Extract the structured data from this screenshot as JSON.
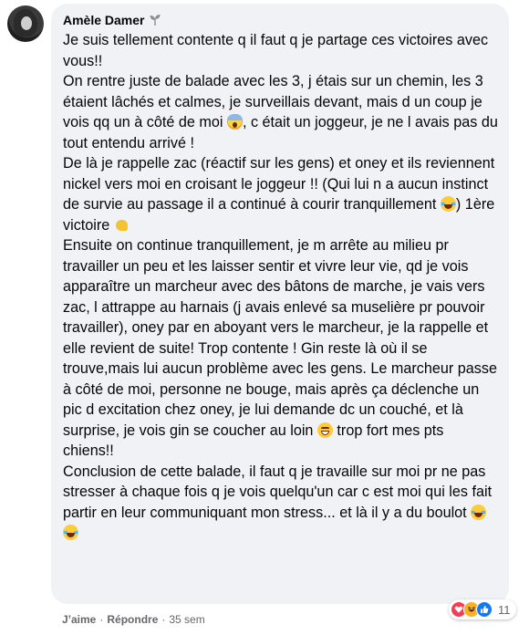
{
  "comment": {
    "author": "Amèle Damer",
    "author_badge_icon": "sprout-badge-icon",
    "paragraphs": [
      [
        "Je suis tellement contente q il faut q je partage ces victoires avec vous!!"
      ],
      [
        "On rentre juste de balade avec les 3, j étais sur un chemin, les 3 étaient lâchés et calmes, je surveillais devant, mais d un coup je vois qq un à côté de moi ",
        "{scream}",
        ", c était un joggeur, je ne l avais pas du tout entendu arrivé !"
      ],
      [
        "De là je rappelle zac (réactif sur les gens) et oney et ils reviennent nickel vers moi en croisant le joggeur !! (Qui lui n a aucun instinct de survie au passage il a continué à courir tranquillement ",
        "{laugh}",
        ") 1ère victoire ",
        "{muscle}"
      ],
      [
        "Ensuite on continue tranquillement, je m arrête au milieu pr travailler un peu et les laisser sentir et vivre leur vie, qd je vois apparaître un marcheur avec des bâtons de marche, je vais vers zac, l attrappe au harnais (j avais enlevé sa muselière pr pouvoir travailler), oney par en aboyant vers le marcheur, je la rappelle et elle revient de suite! Trop contente ! Gin reste là où il se trouve,mais lui aucun problème avec les gens. Le marcheur passe à côté de moi, personne ne bouge, mais après ça déclenche un pic d excitation chez oney, je lui demande dc un couché, et là surprise, je vois gin se coucher au loin ",
        "{grin}",
        " trop fort mes pts chiens!!"
      ],
      [
        "Conclusion de cette balade, il faut q je travaille sur moi pr ne pas stresser à chaque fois q je vois quelqu'un car c est moi qui les fait partir en leur communiquant mon stress... et là il y a du boulot ",
        "{laugh}",
        "{laugh}"
      ]
    ]
  },
  "reactions": {
    "icons": [
      "love-reaction-icon",
      "haha-reaction-icon",
      "like-reaction-icon"
    ],
    "count": "11"
  },
  "actions": {
    "like": "J’aime",
    "reply": "Répondre",
    "separator": "·",
    "time": "35 sem"
  },
  "colors": {
    "bubble_bg": "#f0f2f5",
    "text": "#050505",
    "secondary": "#65676b",
    "like_blue": "#1877f2",
    "love_red": "#f33e58",
    "haha_yellow": "#f7b125"
  }
}
